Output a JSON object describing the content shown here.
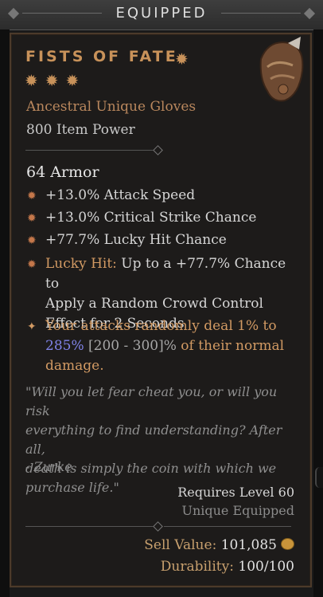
{
  "header": {
    "title": "EQUIPPED"
  },
  "item": {
    "name": "FISTS OF FATE",
    "type": "Ancestral Unique Gloves",
    "power": "800 Item Power",
    "armor": "64 Armor"
  },
  "affixes": [
    {
      "text": "+13.0% Attack Speed"
    },
    {
      "text": "+13.0% Critical Strike Chance"
    },
    {
      "text": "+77.7% Lucky Hit Chance"
    }
  ],
  "lucky_hit": {
    "label": "Lucky Hit:",
    "line1": " Up to a +77.7% Chance to",
    "line2": "Apply a Random Crowd Control",
    "line3": "Effect for 2 Seconds"
  },
  "unique_power": {
    "line1": "Your attacks randomly deal 1% to",
    "value": "285%",
    "range": " [200 - 300]%",
    "line2_rest": " of their normal",
    "line3": "damage."
  },
  "flavor": {
    "lines": [
      "\"Will you let fear cheat you, or will you risk",
      "everything to find understanding? After all,",
      "death is simply the coin with which we",
      "purchase life.\""
    ],
    "author": "- Zurke"
  },
  "requirements": {
    "level": "Requires Level 60",
    "unique_equipped": "Unique Equipped"
  },
  "footer": {
    "sell_label": "Sell Value:",
    "sell_value": " 101,085",
    "durability_label": "Durability:",
    "durability_value": " 100/100"
  },
  "colors": {
    "unique_orange": "#c8925a",
    "affix_bullet": "#c4774a",
    "highlight_blue": "#7f82e6"
  }
}
